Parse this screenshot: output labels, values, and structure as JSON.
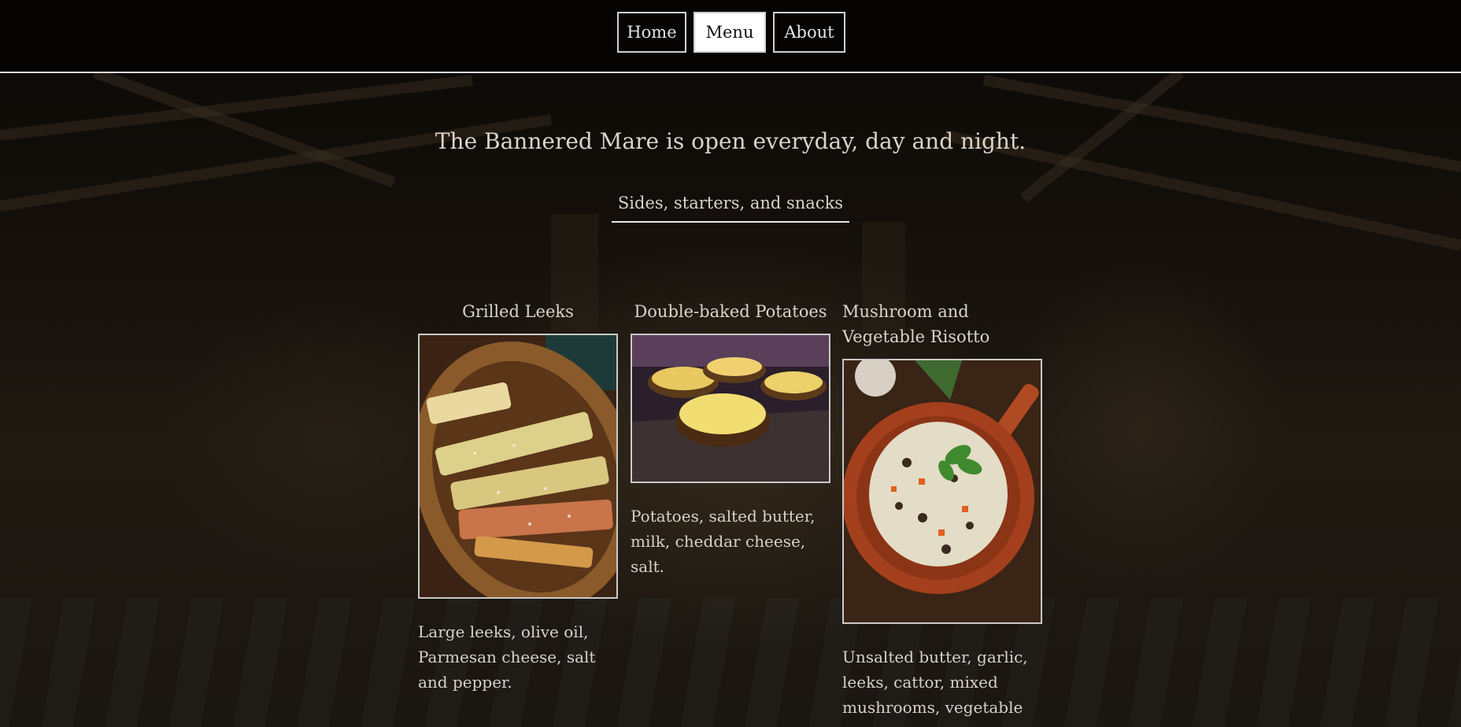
{
  "nav": {
    "home_label": "Home",
    "menu_label": "Menu",
    "about_label": "About",
    "active": "Menu"
  },
  "headline": "The Bannered Mare is open everyday, day and night.",
  "section": {
    "title": "Sides, starters, and snacks"
  },
  "items": [
    {
      "name": "Grilled Leeks",
      "description": "Large leeks, olive oil, Parmesan cheese, salt and pepper."
    },
    {
      "name": "Double-baked Potatoes",
      "description": "Potatoes, salted butter, milk, cheddar cheese, salt."
    },
    {
      "name": "Mushroom and Vegetable Risotto",
      "description": "Unsalted butter, garlic, leeks, cattor, mixed mushrooms, vegetable"
    }
  ],
  "colors": {
    "nav_active_bg": "#ffffff",
    "nav_border": "#cfcfcf",
    "text": "#d9d4c8",
    "background": "#15100b"
  }
}
